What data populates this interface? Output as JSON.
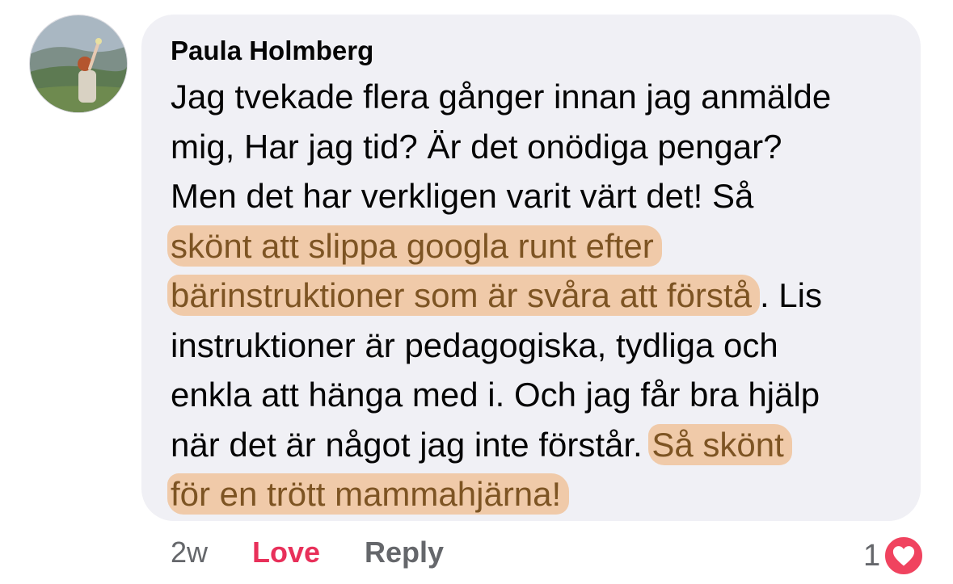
{
  "comment": {
    "author": "Paula Holmberg",
    "avatar_icon": "profile-photo-avatar",
    "lines": [
      {
        "text": "Jag tvekade flera gånger innan jag anmälde"
      },
      {
        "text": "mig, Har jag tid? Är det onödiga pengar?"
      },
      {
        "text": "Men det har verkligen varit värt det! Så"
      },
      {
        "highlight": "skönt att slippa googla runt efter"
      },
      {
        "highlight": "bärinstruktioner som är svåra att förstå",
        "after": ". Lis"
      },
      {
        "text": "instruktioner är pedagogiska, tydliga och"
      },
      {
        "text": "enkla att hänga med i. Och jag får bra hjälp"
      },
      {
        "before": "när det är något jag inte förstår. ",
        "highlight": "Så skönt"
      },
      {
        "highlight": "för en trött mammahjärna!"
      }
    ],
    "highlight_color": "#f0b076"
  },
  "actions": {
    "time": "2w",
    "love_label": "Love",
    "reply_label": "Reply",
    "reaction_count": "1",
    "reaction_icon": "heart-icon",
    "love_color": "#e8305a"
  }
}
